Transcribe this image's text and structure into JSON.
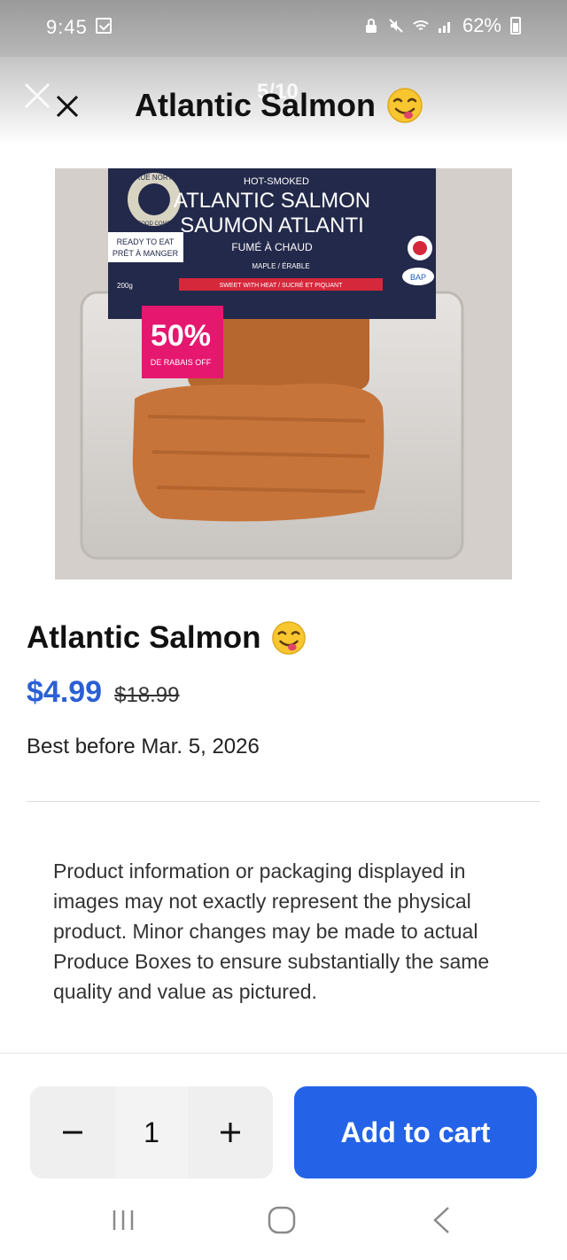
{
  "status_bar": {
    "time": "9:45",
    "battery": "62%"
  },
  "header": {
    "counter": "5/10",
    "title": "Atlantic Salmon",
    "title_emoji": "face-savoring-food-emoji"
  },
  "product_image": {
    "package": {
      "brand": "TRUE NORTH",
      "brand_sub": "SEAFOOD COMPANY",
      "kicker": "HOT-SMOKED",
      "name_en": "ATLANTIC SALMON",
      "name_fr": "SAUMON ATLANTI",
      "sub_fr": "FUMÉ À CHAUD",
      "ready_to_eat": "READY TO EAT",
      "ready_fr": "PRÊT À MANGER",
      "flavour": "MAPLE / ÉRABLE",
      "taste": "SWEET WITH HEAT / SUCRÉ ET PIQUANT",
      "weight": "200g",
      "bap": "BAP",
      "sticker_pct": "50%",
      "sticker_text": "DE RABAIS OFF"
    }
  },
  "product": {
    "name": "Atlantic Salmon",
    "price": "$4.99",
    "old_price": "$18.99",
    "best_before": "Best before Mar. 5, 2026"
  },
  "disclaimer": "Product information or packaging displayed in images may not exactly represent the physical product. Minor changes may be made to actual Produce Boxes to ensure substantially the same quality and value as pictured.",
  "cart": {
    "quantity": "1",
    "add_label": "Add to cart"
  },
  "colors": {
    "accent": "#2463e8",
    "price": "#2b5fd4"
  }
}
